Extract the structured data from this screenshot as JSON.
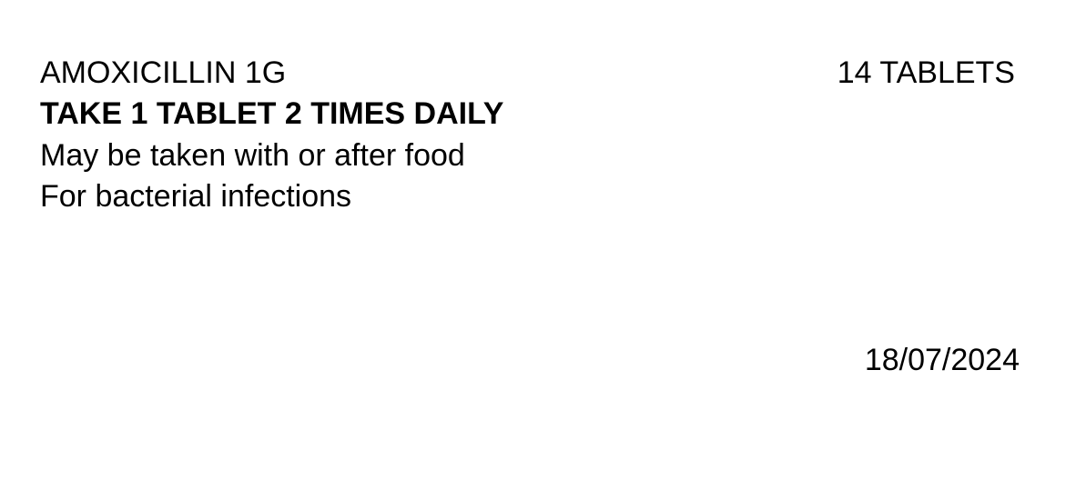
{
  "label": {
    "drug_name": "AMOXICILLIN 1G",
    "quantity": "14 TABLETS",
    "directions": "TAKE 1 TABLET 2 TIMES DAILY",
    "advice_lines": [
      "May be taken with or after food",
      "For bacterial infections"
    ],
    "date": "18/07/2024"
  },
  "colors": {
    "background": "#ffffff",
    "text": "#000000"
  }
}
